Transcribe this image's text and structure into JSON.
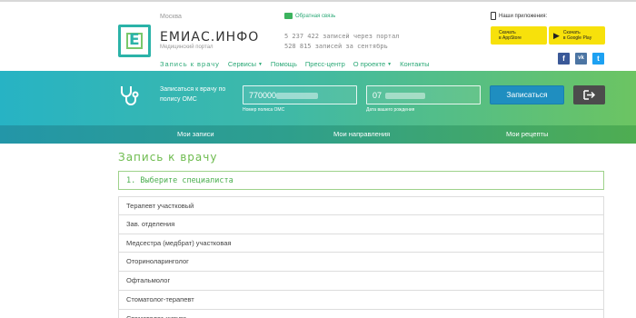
{
  "header": {
    "city": "Москва",
    "site_name": "ЕМИАС.ИНФО",
    "site_sub": "Медицинский портал",
    "feedback": "Обратная связь",
    "stats_line1": "5 237 422  записей через портал",
    "stats_line2": "528 815  записей за сентябрь",
    "apps_label": "Наши приложения:",
    "appstore_line1": "Скачать",
    "appstore_line2": "в AppStore",
    "googleplay_line1": "Скачать",
    "googleplay_line2": "в Google Play",
    "social": {
      "fb": "f",
      "vk": "vk",
      "tw": "t"
    }
  },
  "nav": {
    "items": [
      {
        "label": "Запись к врачу"
      },
      {
        "label": "Сервисы"
      },
      {
        "label": "Помощь"
      },
      {
        "label": "Пресс-центр"
      },
      {
        "label": "О проекте"
      },
      {
        "label": "Контакты"
      }
    ]
  },
  "login": {
    "label": "Записаться к врачу по полису ОМС",
    "policy_value": "770000",
    "policy_caption": "Номер полиса ОМС",
    "birth_value": "07",
    "birth_caption": "Дата вашего рождения",
    "submit_label": "Записаться"
  },
  "tabs": [
    {
      "label": "Мои записи"
    },
    {
      "label": "Мои направления"
    },
    {
      "label": "Мои рецепты"
    }
  ],
  "main": {
    "title": "Запись к врачу",
    "step": "1. Выберите специалиста",
    "specialists": [
      "Терапевт участковый",
      "Зав. отделения",
      "Медсестра (медбрат) участковая",
      "Оториноларинголог",
      "Офтальмолог",
      "Стоматолог-терапевт",
      "Стоматолог-хирург"
    ]
  },
  "colors": {
    "accent_green": "#2aa876",
    "title_green": "#6dbb4e",
    "button_blue": "#1f8ec0",
    "store_yellow": "#f7e10b"
  }
}
